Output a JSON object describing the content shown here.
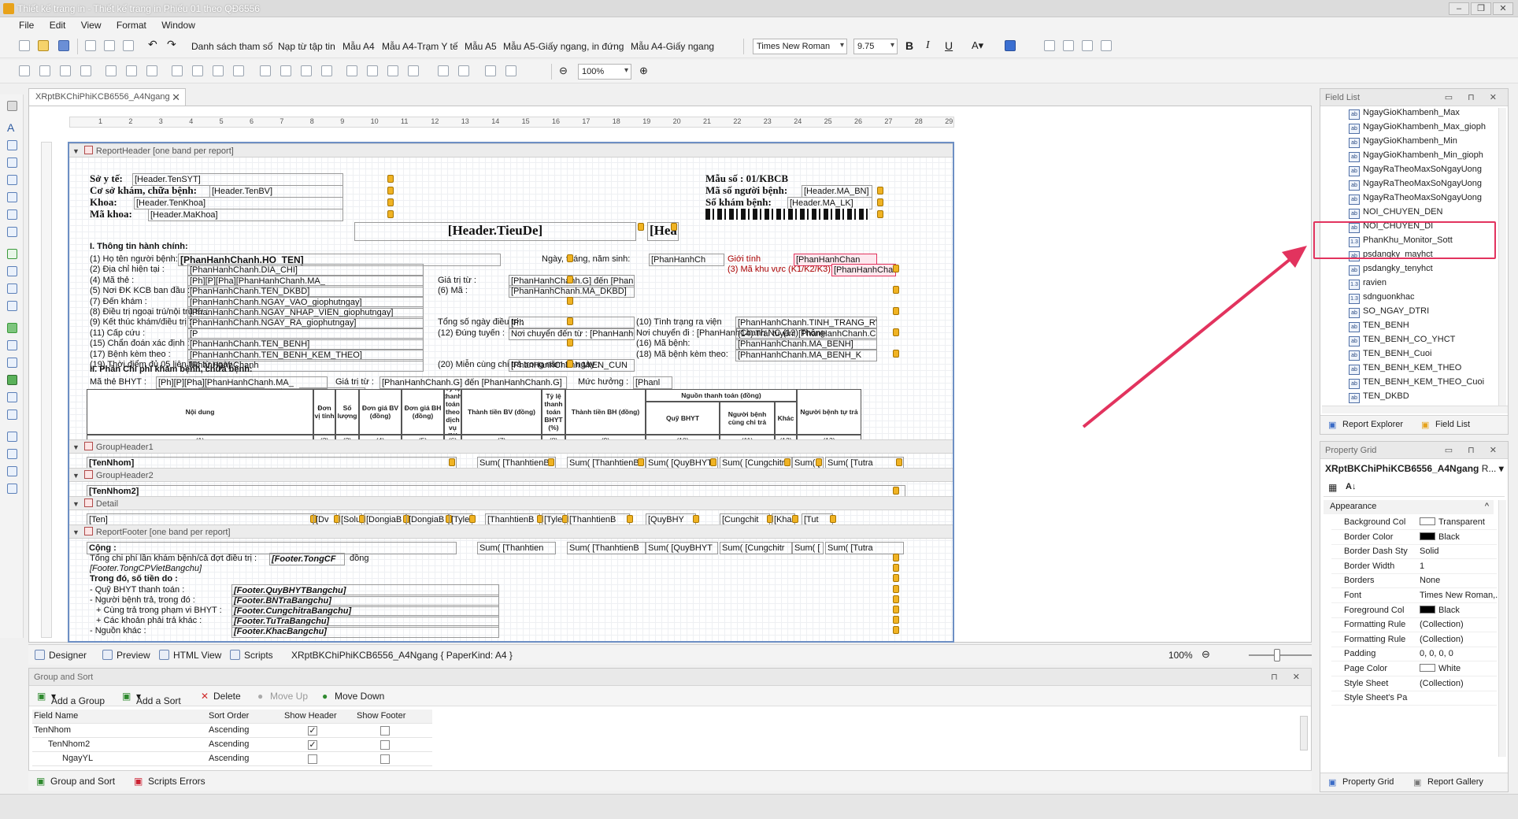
{
  "window": {
    "title": "Thiết kế trang in - Thiết kế trang in Phiếu 01 theo QĐ6556"
  },
  "menu": [
    "File",
    "Edit",
    "View",
    "Format",
    "Window"
  ],
  "toolbar": {
    "templates": [
      "Danh sách tham số",
      "Nạp từ tập tin",
      "Mẫu A4",
      "Mẫu A4-Trạm Y tế",
      "Mẫu A5",
      "Mẫu A5-Giấy ngang, in đứng",
      "Mẫu A4-Giấy ngang"
    ],
    "font_name": "Times New Roman",
    "font_size": "9.75",
    "zoom": "100%"
  },
  "document_tab": "XRptBKChiPhiKCB6556_A4Ngang",
  "ruler_numbers": [
    "1",
    "2",
    "3",
    "4",
    "5",
    "6",
    "7",
    "8",
    "9",
    "10",
    "11",
    "12",
    "13",
    "14",
    "15",
    "16",
    "17",
    "18",
    "19",
    "20",
    "21",
    "22",
    "23",
    "24",
    "25",
    "26",
    "27",
    "28",
    "29"
  ],
  "bands": {
    "report_header": "ReportHeader [one band per report]",
    "group_header1": "GroupHeader1",
    "group_header2": "GroupHeader2",
    "detail": "Detail",
    "report_footer": "ReportFooter [one band per report]"
  },
  "report": {
    "header_left": [
      {
        "label": "Sở y tế:",
        "field": "[Header.TenSYT]"
      },
      {
        "label": "Cơ sở khám, chữa bệnh:",
        "field": "[Header.TenBV]"
      },
      {
        "label": "Khoa:",
        "field": "[Header.TenKhoa]"
      },
      {
        "label": "Mã khoa:",
        "field": "[Header.MaKhoa]"
      }
    ],
    "header_right": [
      {
        "label": "Mẫu số : 01/KBCB",
        "field": ""
      },
      {
        "label": "Mã số người bệnh:",
        "field": "[Header.MA_BN]"
      },
      {
        "label": "Số khám bệnh:",
        "field": "[Header.MA_LK]"
      }
    ],
    "title_field": "[Header.TieuDe]",
    "title_side": "[Hea",
    "section1": "I. Thông tin hành chính:",
    "rows1": [
      {
        "a": "(1) Họ tên người bệnh:",
        "b": "[PhanHanhChanh.HO_TEN]",
        "c": "Ngày, tháng, năm sinh:",
        "d": "[PhanHanhCh",
        "e": "Giới tính",
        "f": "[PhanHanhChan"
      },
      {
        "a": "(2) Địa chỉ hiện tại :",
        "b": "[PhanHanhChanh.DIA_CHI]",
        "e": "(3) Mã khu vực (K1/K2/K3):",
        "f": "[PhanHanhChanh"
      },
      {
        "a": "(4) Mã thẻ :",
        "b": "[Ph][P][Pha][PhanHanhChanh.MA_",
        "c": "Giá trị từ :",
        "d": "[PhanHanhChanh.G] đến [PhanHanhChanh.G]"
      },
      {
        "a": "(5) Nơi ĐK KCB ban đầu :",
        "b": "[PhanHanhChanh.TEN_DKBD]",
        "c": "(6) Mã :",
        "d": "[PhanHanhChanh.MA_DKBD]"
      },
      {
        "a": "(7) Đến khám :",
        "b": "[PhanHanhChanh.NGAY_VAO_giophutngay]"
      },
      {
        "a": "(8) Điều trị ngoại trú/nội trú từ :",
        "b": "[PhanHanhChanh.NGAY_NHAP_VIEN_giophutngay]"
      },
      {
        "a": "(9) Kết thúc khám/điều trị :",
        "b": "[PhanHanhChanh.NGAY_RA_giophutngay]",
        "c": "Tổng số ngày điều trị :",
        "d": "[Ph",
        "e": "(10) Tình trạng ra viện",
        "f": "[PhanHanhChanh.TINH_TRANG_RV]"
      },
      {
        "a": "(11) Cấp cứu :",
        "b": "[P",
        "c": "(12) Đúng tuyến :",
        "d": "Nơi chuyển đến từ : [PhanHanhChanh.NOI_CHUYEN_DE",
        "e": "Nơi chuyển đi : [PhanHanhChanh.NC (13) Thông tuyến: [Pha",
        "f": "(14) Trái tuyến: [PhanHanhChanh.CH"
      },
      {
        "a": "(15) Chẩn đoán xác định :",
        "b": "[PhanHanhChanh.TEN_BENH]",
        "e": "(16) Mã bệnh:",
        "f": "[PhanHanhChanh.MA_BENH]"
      },
      {
        "a": "(17) Bệnh kèm theo :",
        "b": "[PhanHanhChanh.TEN_BENH_KEM_THEO]",
        "e": "(18) Mã bệnh kèm theo:",
        "f": "[PhanHanhChanh.MA_BENH_K"
      },
      {
        "a": "(19) Thời điểm đủ 05 liên tục từ ngày :",
        "b": "[PhanHanhChanh",
        "c": "(20) Miễn cùng chi trả trong năm từ ngày :",
        "d": "[PhanHanhChanh.MIEN_CUN"
      }
    ],
    "section2": "II. Phần Chi phí khám bệnh, chữa bệnh:",
    "rows2": [
      {
        "a": "Mã thẻ BHYT :",
        "b": "[Ph][P][Pha][PhanHanhChanh.MA_",
        "c": "Giá trị từ :",
        "d": "[PhanHanhChanh.G] đến [PhanHanhChanh.G]",
        "e": "Mức hưởng :",
        "f": "[Phanl"
      },
      {
        "a": "Chi phí KBCB tính từ ngày",
        "b": "[PhanHanhCh",
        "c": "đến",
        "d": "[PhanHanhCh"
      }
    ],
    "table_headers": [
      "Nội dung",
      "Đơn vị tính",
      "Số lượng",
      "Đơn giá BV (đồng)",
      "Đơn giá BH (đồng)",
      "Tỷ lệ thanh toán theo dịch vụ (%)",
      "Thành tiền BV (đồng)",
      "Tỷ lệ thanh toán BHYT (%)",
      "Thành tiền BH (đồng)",
      "Nguồn thanh toán (đồng)",
      "Quỹ BHYT",
      "Người bệnh cùng chi trả",
      "Khác",
      "Người bệnh tự trả"
    ],
    "table_numbers": [
      "(1)",
      "(2)",
      "(3)",
      "(4)",
      "(5)",
      "(6)",
      "(7)",
      "(8)",
      "(9)",
      "(10)",
      "(11)",
      "(12)",
      "(13)"
    ],
    "group1_row": [
      "[TenNhom]",
      "Sum( [ThanhtienB",
      "Sum( [ThanhtienB",
      "Sum( [QuyBHYT",
      "Sum( [Cungchitr",
      "Sum( [",
      "Sum( [Tutra"
    ],
    "group2_row": [
      "[TenNhom2]"
    ],
    "detail_row": [
      "[Ten]",
      "[Dv",
      "[Solu",
      "[DongiaB",
      "[DongiaB",
      "[Tyle",
      "[ThanhtienB",
      "[TyleT",
      "[ThanhtienB",
      "[QuyBHY",
      "[Cungchit",
      "[Kha",
      "[Tut"
    ],
    "footer": {
      "total_row": [
        "Cộng :",
        "Sum( [Thanhtien",
        "Sum( [ThanhtienB",
        "Sum( [QuyBHYT",
        "Sum( [Cungchitr",
        "Sum( [",
        "Sum( [Tutra"
      ],
      "lines": [
        {
          "a": "Tổng chi phí lần khám bệnh/cả đợt điều trị :",
          "b": "[Footer.TongCF",
          "c": "đồng"
        },
        {
          "a": "[Footer.TongCPVietBangchu]",
          "b": "",
          "c": ""
        },
        {
          "a": "Trong đó, số tiền do :",
          "b": "",
          "c": ""
        },
        {
          "a": "- Quỹ BHYT thanh toán :",
          "b": "[Footer.QuyBHYTBangchu]",
          "c": ""
        },
        {
          "a": "- Người bệnh trả, trong đó :",
          "b": "[Footer.BNTraBangchu]",
          "c": ""
        },
        {
          "a": "+ Cùng trả trong phạm vi BHYT :",
          "b": "[Footer.CungchitraBangchu]",
          "c": ""
        },
        {
          "a": "+ Các khoản phải trả khác :",
          "b": "[Footer.TuTraBangchu]",
          "c": ""
        },
        {
          "a": "- Nguồn khác :",
          "b": "[Footer.KhacBangchu]",
          "c": ""
        }
      ]
    }
  },
  "bottom_tabs": {
    "designer": "Designer",
    "preview": "Preview",
    "html": "HTML View",
    "scripts": "Scripts",
    "info": "XRptBKChiPhiKCB6556_A4Ngang { PaperKind: A4 }",
    "zoom": "100%"
  },
  "group_sort": {
    "title": "Group and Sort",
    "actions": [
      "Add a Group",
      "Add a Sort",
      "Delete",
      "Move Up",
      "Move Down"
    ],
    "columns": [
      "Field Name",
      "Sort Order",
      "Show Header",
      "Show Footer"
    ],
    "rows": [
      {
        "field": "TenNhom",
        "order": "Ascending",
        "header": "✓",
        "footer": ""
      },
      {
        "field": "TenNhom2",
        "order": "Ascending",
        "header": "✓",
        "footer": ""
      },
      {
        "field": "NgayYL",
        "order": "Ascending",
        "header": "",
        "footer": ""
      }
    ],
    "tabs": [
      "Group and Sort",
      "Scripts Errors"
    ]
  },
  "field_list": {
    "title": "Field List",
    "items": [
      {
        "type": "ab",
        "name": "NgayGioKhambenh_Max"
      },
      {
        "type": "ab",
        "name": "NgayGioKhambenh_Max_gioph"
      },
      {
        "type": "ab",
        "name": "NgayGioKhambenh_Min"
      },
      {
        "type": "ab",
        "name": "NgayGioKhambenh_Min_gioph"
      },
      {
        "type": "ab",
        "name": "NgayRaTheoMaxSoNgayUong"
      },
      {
        "type": "ab",
        "name": "NgayRaTheoMaxSoNgayUong"
      },
      {
        "type": "ab",
        "name": "NgayRaTheoMaxSoNgayUong"
      },
      {
        "type": "ab",
        "name": "NOI_CHUYEN_DEN"
      },
      {
        "type": "ab",
        "name": "NOI_CHUYEN_DI"
      },
      {
        "type": "1.3",
        "name": "PhanKhu_Monitor_Sott"
      },
      {
        "type": "ab",
        "name": "psdangky_mayhct"
      },
      {
        "type": "ab",
        "name": "psdangky_tenyhct"
      },
      {
        "type": "1.3",
        "name": "ravien"
      },
      {
        "type": "1.3",
        "name": "sdnguonkhac"
      },
      {
        "type": "ab",
        "name": "SO_NGAY_DTRI"
      },
      {
        "type": "ab",
        "name": "TEN_BENH"
      },
      {
        "type": "ab",
        "name": "TEN_BENH_CO_YHCT"
      },
      {
        "type": "ab",
        "name": "TEN_BENH_Cuoi"
      },
      {
        "type": "ab",
        "name": "TEN_BENH_KEM_THEO"
      },
      {
        "type": "ab",
        "name": "TEN_BENH_KEM_THEO_Cuoi"
      },
      {
        "type": "ab",
        "name": "TEN_DKBD"
      }
    ],
    "tabs": [
      "Report Explorer",
      "Field List"
    ]
  },
  "property_grid": {
    "title": "Property Grid",
    "object": "XRptBKChiPhiKCB6556_A4Ngang",
    "object_suffix": "R...",
    "section": "Appearance",
    "rows": [
      {
        "name": "Background Col",
        "value": "Transparent",
        "swatch": "#ffffff"
      },
      {
        "name": "Border Color",
        "value": "Black",
        "swatch": "#000000"
      },
      {
        "name": "Border Dash Sty",
        "value": "Solid",
        "swatch": ""
      },
      {
        "name": "Border Width",
        "value": "1",
        "swatch": ""
      },
      {
        "name": "Borders",
        "value": "None",
        "swatch": ""
      },
      {
        "name": "Font",
        "value": "Times New Roman,...",
        "swatch": ""
      },
      {
        "name": "Foreground Col",
        "value": "Black",
        "swatch": "#000000"
      },
      {
        "name": "Formatting Rule",
        "value": "(Collection)",
        "swatch": ""
      },
      {
        "name": "Formatting Rule",
        "value": "(Collection)",
        "swatch": ""
      },
      {
        "name": "Padding",
        "value": "0, 0, 0, 0",
        "swatch": ""
      },
      {
        "name": "Page Color",
        "value": "White",
        "swatch": "#ffffff"
      },
      {
        "name": "Style Sheet",
        "value": "(Collection)",
        "swatch": ""
      },
      {
        "name": "Style Sheet's Pa",
        "value": "",
        "swatch": ""
      }
    ],
    "tabs": [
      "Property Grid",
      "Report Gallery"
    ]
  },
  "colors": {
    "highlight": "#e2335e",
    "page_border": "#6d8fc4"
  }
}
